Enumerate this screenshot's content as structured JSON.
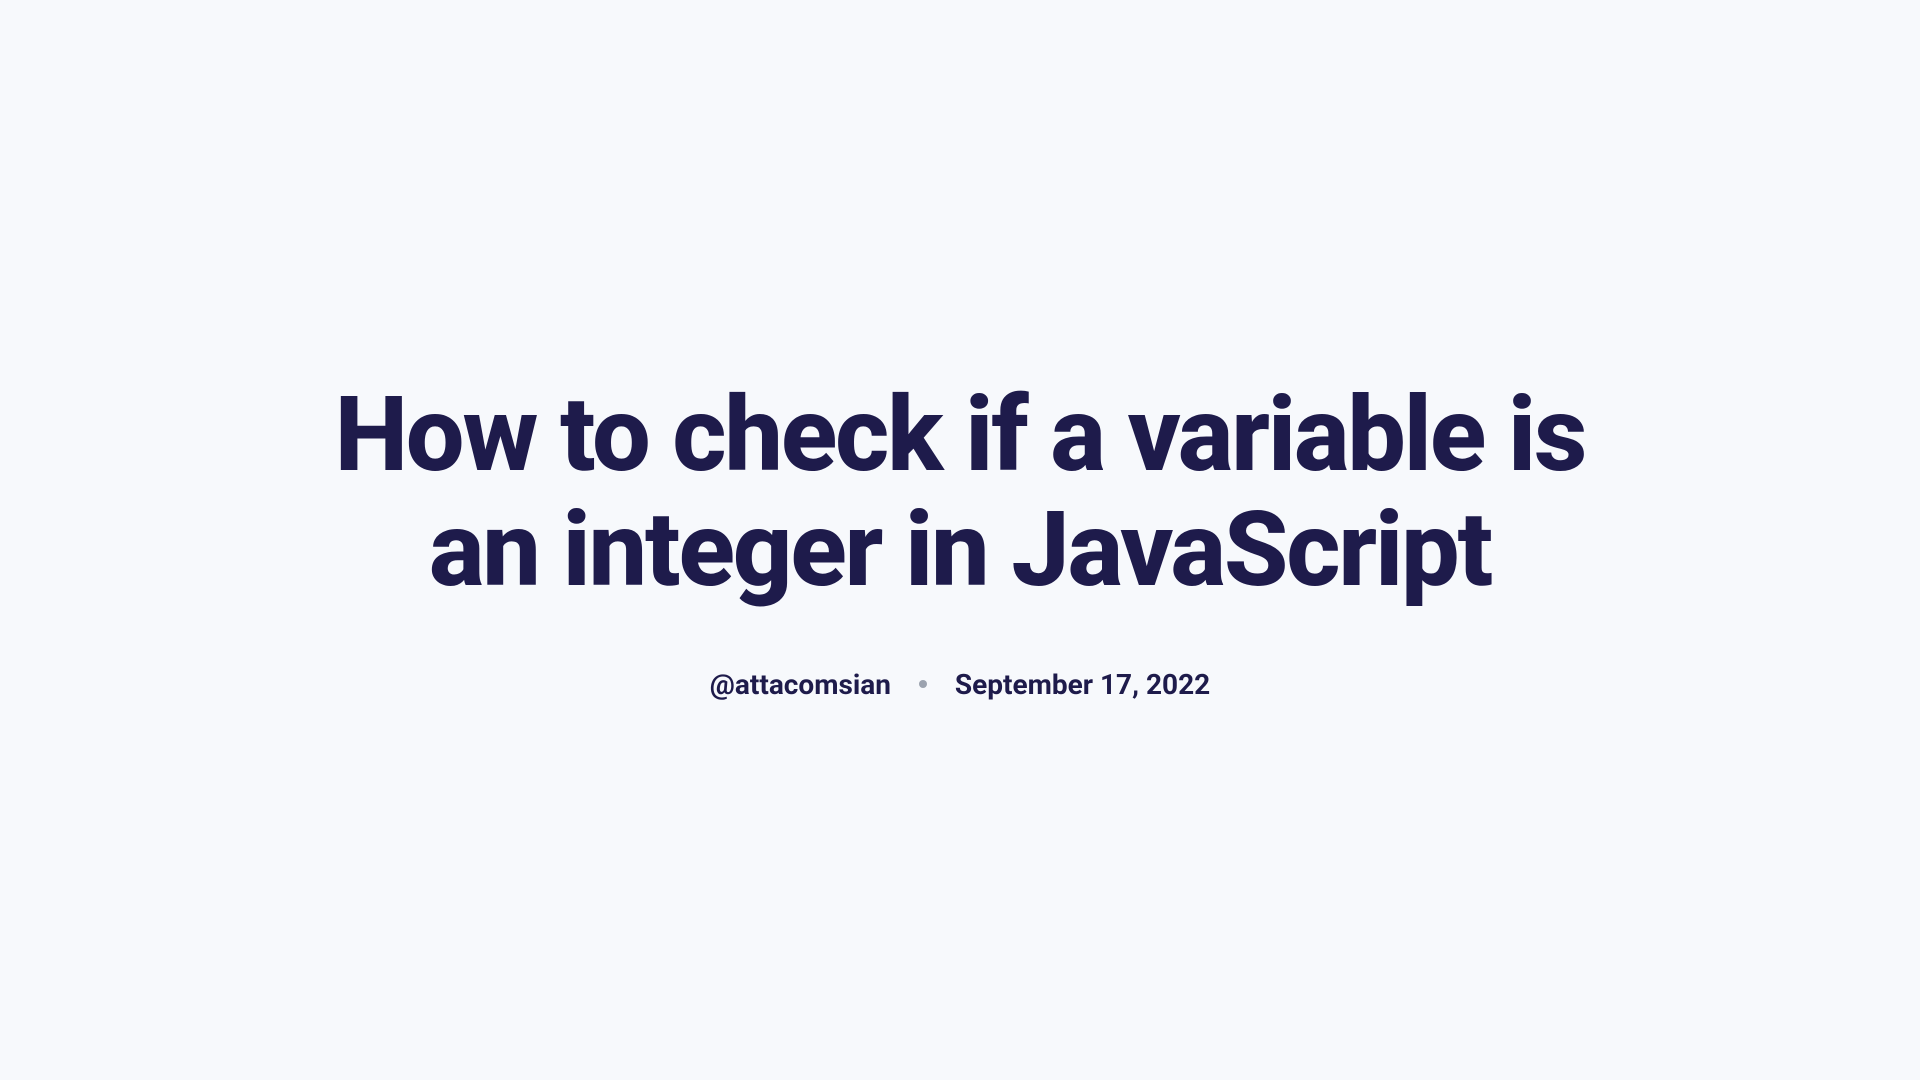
{
  "title": "How to check if a variable is an integer in JavaScript",
  "author": "@attacomsian",
  "date": "September 17, 2022"
}
